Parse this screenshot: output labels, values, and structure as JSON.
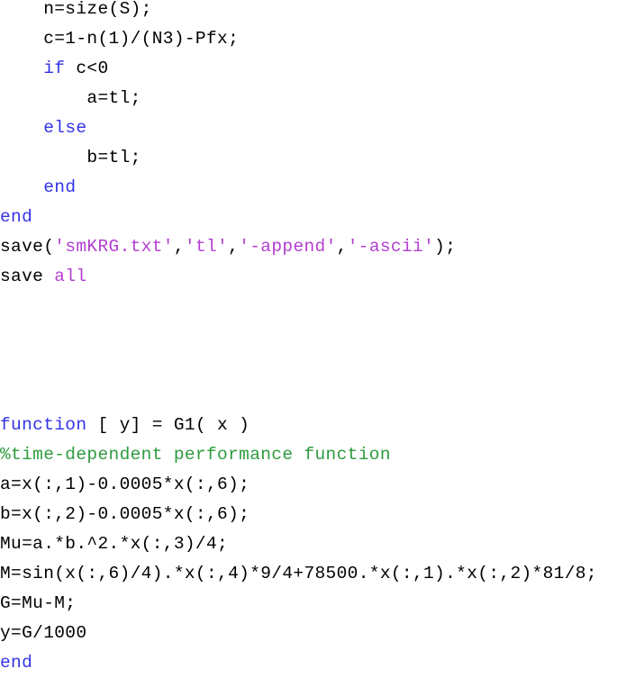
{
  "document": {
    "kind": "matlab-code-listing",
    "background_color": "#ffffff",
    "colors": {
      "plain": "#000000",
      "keyword": "#3333e6",
      "string": "#b23fd0",
      "comment": "#2e9b3e"
    }
  },
  "code": {
    "lines": [
      {
        "id": "line-1",
        "text": "    n=size(S);",
        "tokens": [
          {
            "text": "    n=size(S);",
            "type": "plain"
          }
        ]
      },
      {
        "id": "line-2",
        "text": "    c=1-n(1)/(N3)-Pfx;",
        "tokens": [
          {
            "text": "    c=1-n(1)/(N3)-Pfx;",
            "type": "plain"
          }
        ]
      },
      {
        "id": "line-3",
        "text": "    if c<0",
        "tokens": [
          {
            "text": "    ",
            "type": "plain"
          },
          {
            "text": "if",
            "type": "keyword"
          },
          {
            "text": " c<0",
            "type": "plain"
          }
        ]
      },
      {
        "id": "line-4",
        "text": "        a=tl;",
        "tokens": [
          {
            "text": "        a=tl;",
            "type": "plain"
          }
        ]
      },
      {
        "id": "line-5",
        "text": "    else",
        "tokens": [
          {
            "text": "    ",
            "type": "plain"
          },
          {
            "text": "else",
            "type": "keyword"
          }
        ]
      },
      {
        "id": "line-6",
        "text": "        b=tl;",
        "tokens": [
          {
            "text": "        b=tl;",
            "type": "plain"
          }
        ]
      },
      {
        "id": "line-7",
        "text": "    end",
        "tokens": [
          {
            "text": "    ",
            "type": "plain"
          },
          {
            "text": "end",
            "type": "keyword"
          }
        ]
      },
      {
        "id": "line-8",
        "text": "end",
        "tokens": [
          {
            "text": "end",
            "type": "keyword"
          }
        ]
      },
      {
        "id": "line-9",
        "text": "save('smKRG.txt','tl','-append','-ascii');",
        "tokens": [
          {
            "text": "save(",
            "type": "plain"
          },
          {
            "text": "'smKRG.txt'",
            "type": "string"
          },
          {
            "text": ",",
            "type": "plain"
          },
          {
            "text": "'tl'",
            "type": "string"
          },
          {
            "text": ",",
            "type": "plain"
          },
          {
            "text": "'-append'",
            "type": "string"
          },
          {
            "text": ",",
            "type": "plain"
          },
          {
            "text": "'-ascii'",
            "type": "string"
          },
          {
            "text": ");",
            "type": "plain"
          }
        ]
      },
      {
        "id": "line-10",
        "text": "save all",
        "tokens": [
          {
            "text": "save ",
            "type": "plain"
          },
          {
            "text": "all",
            "type": "string"
          }
        ]
      },
      {
        "id": "line-11",
        "text": "",
        "tokens": [
          {
            "text": " ",
            "type": "blank"
          }
        ]
      },
      {
        "id": "line-12",
        "text": "",
        "tokens": [
          {
            "text": " ",
            "type": "blank"
          }
        ]
      },
      {
        "id": "line-13",
        "text": "",
        "tokens": [
          {
            "text": " ",
            "type": "blank"
          }
        ]
      },
      {
        "id": "line-14",
        "text": "",
        "tokens": [
          {
            "text": " ",
            "type": "blank"
          }
        ]
      },
      {
        "id": "line-15",
        "text": "function [ y] = G1( x )",
        "tokens": [
          {
            "text": "function",
            "type": "keyword"
          },
          {
            "text": " [ y] = G1( x )",
            "type": "plain"
          }
        ]
      },
      {
        "id": "line-16",
        "text": "%time-dependent performance function",
        "tokens": [
          {
            "text": "%time-dependent performance function",
            "type": "comment"
          }
        ]
      },
      {
        "id": "line-17",
        "text": "a=x(:,1)-0.0005*x(:,6);",
        "tokens": [
          {
            "text": "a=x(:,1)-0.0005*x(:,6);",
            "type": "plain"
          }
        ]
      },
      {
        "id": "line-18",
        "text": "b=x(:,2)-0.0005*x(:,6);",
        "tokens": [
          {
            "text": "b=x(:,2)-0.0005*x(:,6);",
            "type": "plain"
          }
        ]
      },
      {
        "id": "line-19",
        "text": "Mu=a.*b.^2.*x(:,3)/4;",
        "tokens": [
          {
            "text": "Mu=a.*b.^2.*x(:,3)/4;",
            "type": "plain"
          }
        ]
      },
      {
        "id": "line-20",
        "text": "M=sin(x(:,6)/4).*x(:,4)*9/4+78500.*x(:,1).*x(:,2)*81/8;",
        "tokens": [
          {
            "text": "M=sin(x(:,6)/4).*x(:,4)*9/4+78500.*x(:,1).*x(:,2)*81/8;",
            "type": "plain"
          }
        ]
      },
      {
        "id": "line-21",
        "text": "G=Mu-M;",
        "tokens": [
          {
            "text": "G=Mu-M;",
            "type": "plain"
          }
        ]
      },
      {
        "id": "line-22",
        "text": "y=G/1000",
        "tokens": [
          {
            "text": "y=G/1000",
            "type": "plain"
          }
        ]
      },
      {
        "id": "line-23",
        "text": "end",
        "tokens": [
          {
            "text": "end",
            "type": "keyword"
          }
        ]
      }
    ]
  }
}
